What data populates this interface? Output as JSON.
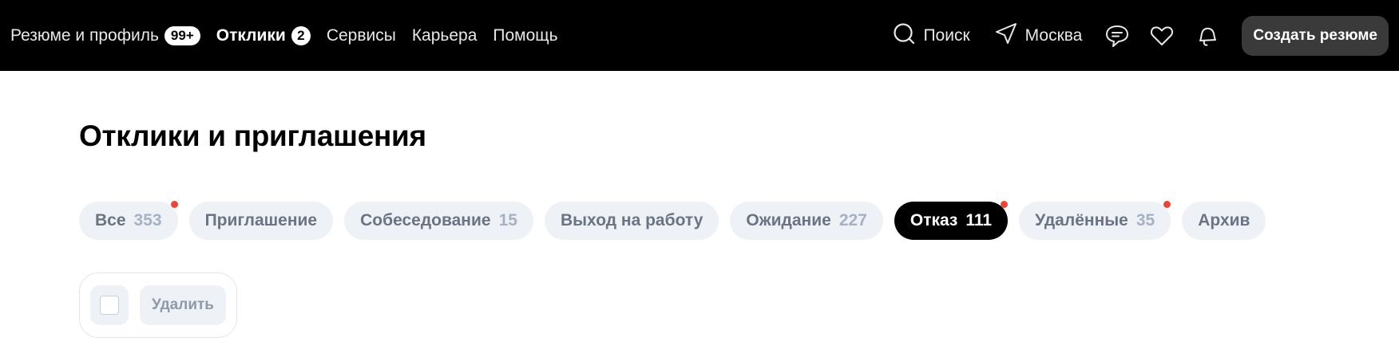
{
  "header": {
    "nav": [
      {
        "label": "Резюме и профиль",
        "badge": "99+"
      },
      {
        "label": "Отклики",
        "badge": "2"
      },
      {
        "label": "Сервисы"
      },
      {
        "label": "Карьера"
      },
      {
        "label": "Помощь"
      }
    ],
    "search_label": "Поиск",
    "city_label": "Москва",
    "create_resume_label": "Создать резюме"
  },
  "main": {
    "title": "Отклики и приглашения",
    "tabs": [
      {
        "label": "Все",
        "count": "353",
        "dot": true
      },
      {
        "label": "Приглашение",
        "count": ""
      },
      {
        "label": "Собеседование",
        "count": "15"
      },
      {
        "label": "Выход на работу",
        "count": ""
      },
      {
        "label": "Ожидание",
        "count": "227"
      },
      {
        "label": "Отказ",
        "count": "111",
        "dot": true,
        "active": true
      },
      {
        "label": "Удалённые",
        "count": "35",
        "dot": true
      },
      {
        "label": "Архив",
        "count": ""
      }
    ],
    "delete_label": "Удалить"
  },
  "colors": {
    "topbar_bg": "#000000",
    "tab_bg": "#eef1f6",
    "active_tab_bg": "#000000",
    "notification_dot": "#e5483a"
  },
  "icons": [
    "search-icon",
    "location-arrow-icon",
    "chat-icon",
    "heart-icon",
    "bell-icon"
  ]
}
